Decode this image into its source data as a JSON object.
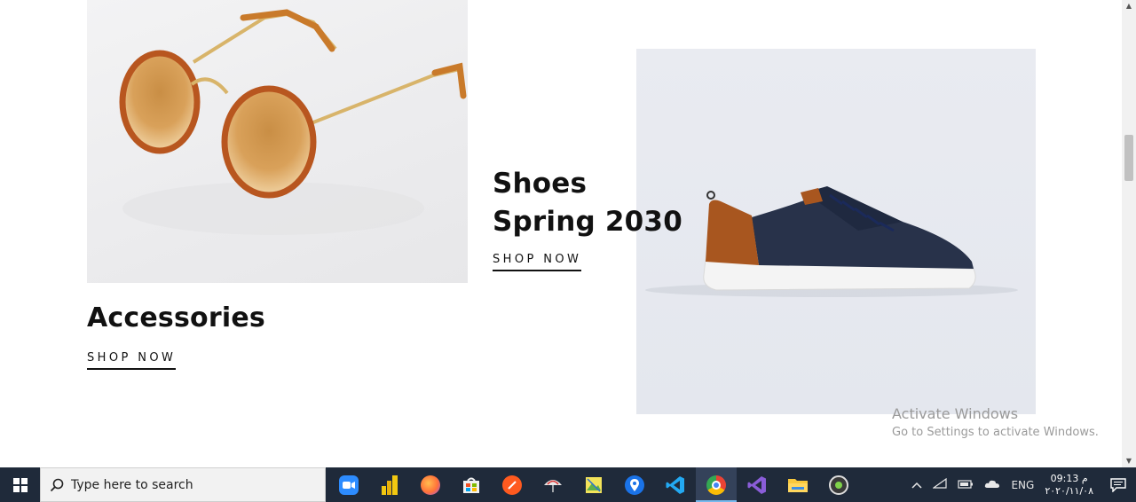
{
  "promos": {
    "accessories": {
      "title": "Accessories",
      "cta": "SHOP NOW"
    },
    "shoes": {
      "title": "Shoes Spring 2030",
      "cta": "SHOP NOW"
    }
  },
  "watermark": {
    "title": "Activate Windows",
    "subtitle": "Go to Settings to activate Windows."
  },
  "taskbar": {
    "search_placeholder": "Type here to search",
    "apps": [
      {
        "name": "zoom",
        "icon": "zoom-icon",
        "color": "#2d8cff"
      },
      {
        "name": "power-bi",
        "icon": "power-bi-icon",
        "color": "#f2c811"
      },
      {
        "name": "firefox",
        "icon": "firefox-icon",
        "color": "#ff7139"
      },
      {
        "name": "store",
        "icon": "store-icon",
        "color": "#ffffff"
      },
      {
        "name": "app-orange",
        "icon": "orange-app-icon",
        "color": "#ff5a1f"
      },
      {
        "name": "app-umbrella",
        "icon": "umbrella-app-icon",
        "color": "#e0e0e0"
      },
      {
        "name": "app-gallery",
        "icon": "gallery-app-icon",
        "color": "#5fb04a"
      },
      {
        "name": "maps",
        "icon": "maps-icon",
        "color": "#1a73e8"
      },
      {
        "name": "vscode",
        "icon": "vscode-icon",
        "color": "#23a9f2"
      },
      {
        "name": "chrome",
        "icon": "chrome-icon",
        "color": "#34a853",
        "active": true
      },
      {
        "name": "visual-studio",
        "icon": "visual-studio-icon",
        "color": "#8a5dd8"
      },
      {
        "name": "file-explorer",
        "icon": "folder-icon",
        "color": "#f8c83c"
      },
      {
        "name": "app-camera",
        "icon": "camera-app-icon",
        "color": "#3a3a3a"
      }
    ],
    "tray": {
      "language": "ENG",
      "time": "09:13 م",
      "date": "٢٠٢٠/١١/٠٨"
    }
  }
}
